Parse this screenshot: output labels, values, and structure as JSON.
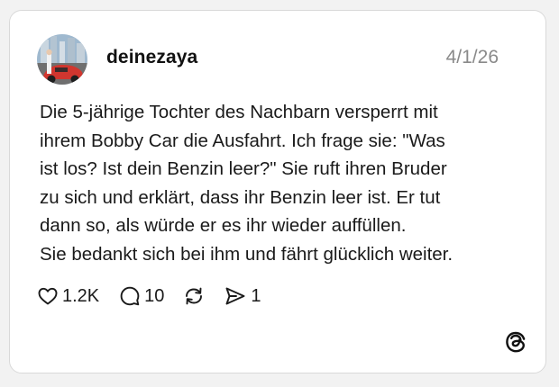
{
  "post": {
    "username": "deinezaya",
    "date": "4/1/26",
    "text_lines": [
      "Die 5-jährige Tochter des Nachbarn versperrt mit",
      "ihrem Bobby Car die Ausfahrt. Ich frage sie: \"Was",
      "ist los? Ist dein Benzin leer?\" Sie ruft ihren Bruder",
      "zu sich und erklärt, dass ihr Benzin leer ist. Er tut",
      "dann so, als würde er es ihr wieder auffüllen.",
      "Sie bedankt sich bei ihm und fährt glücklich weiter."
    ]
  },
  "actions": {
    "like": {
      "icon": "heart-icon",
      "count": "1.2K"
    },
    "reply": {
      "icon": "comment-icon",
      "count": "10"
    },
    "repost": {
      "icon": "repost-icon"
    },
    "share": {
      "icon": "send-icon",
      "count": "1"
    }
  },
  "branding": {
    "icon": "threads-logo-icon"
  },
  "colors": {
    "text": "#1a1a1a",
    "muted": "#8a8a8a",
    "card_border": "#d9d9d9",
    "background": "#f2f2f2"
  }
}
